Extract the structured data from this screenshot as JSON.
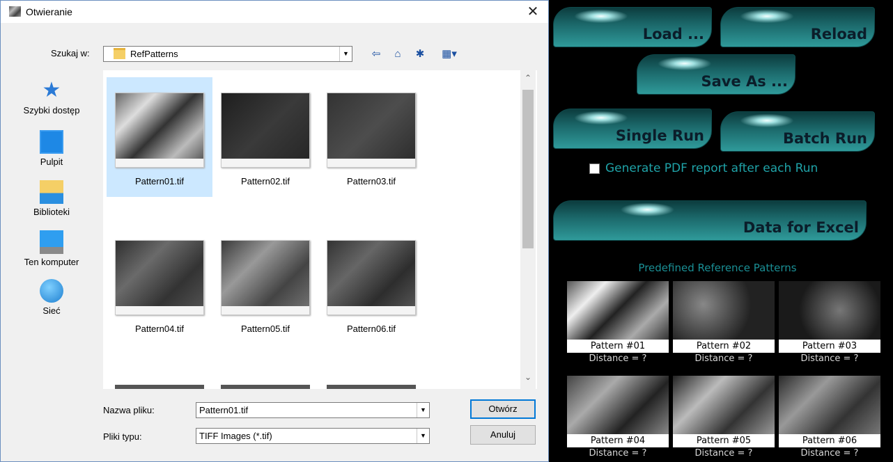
{
  "dialog": {
    "title": "Otwieranie",
    "close_icon": "close-icon",
    "look_in_label": "Szukaj w:",
    "look_in_value": "RefPatterns",
    "toolbar_icons": [
      "back-icon",
      "up-folder-icon",
      "new-folder-icon",
      "view-menu-icon"
    ],
    "places": [
      {
        "label": "Szybki dostęp",
        "icon": "star-icon"
      },
      {
        "label": "Pulpit",
        "icon": "desktop-icon"
      },
      {
        "label": "Biblioteki",
        "icon": "library-icon"
      },
      {
        "label": "Ten komputer",
        "icon": "computer-icon"
      },
      {
        "label": "Sieć",
        "icon": "network-icon"
      }
    ],
    "files": [
      {
        "name": "Pattern01.tif",
        "selected": true
      },
      {
        "name": "Pattern02.tif",
        "selected": false
      },
      {
        "name": "Pattern03.tif",
        "selected": false
      },
      {
        "name": "Pattern04.tif",
        "selected": false
      },
      {
        "name": "Pattern05.tif",
        "selected": false
      },
      {
        "name": "Pattern06.tif",
        "selected": false
      }
    ],
    "filename_label": "Nazwa pliku:",
    "filename_value": "Pattern01.tif",
    "filetype_label": "Pliki typu:",
    "filetype_value": "TIFF Images (*.tif)",
    "open_button": "Otwórz",
    "cancel_button": "Anuluj"
  },
  "app": {
    "buttons": {
      "load": "Load ...",
      "reload": "Reload",
      "save_as": "Save As ...",
      "single_run": "Single Run",
      "batch_run": "Batch Run",
      "data_for_excel": "Data for Excel"
    },
    "pdf_checkbox_label": "Generate PDF report after each Run",
    "pdf_checkbox_checked": false,
    "patterns_title": "Predefined Reference Patterns",
    "patterns": [
      {
        "label": "Pattern #01",
        "distance": "Distance = ?"
      },
      {
        "label": "Pattern #02",
        "distance": "Distance = ?"
      },
      {
        "label": "Pattern #03",
        "distance": "Distance = ?"
      },
      {
        "label": "Pattern #04",
        "distance": "Distance = ?"
      },
      {
        "label": "Pattern #05",
        "distance": "Distance = ?"
      },
      {
        "label": "Pattern #06",
        "distance": "Distance = ?"
      }
    ],
    "accent_color": "#1fa3a8"
  }
}
